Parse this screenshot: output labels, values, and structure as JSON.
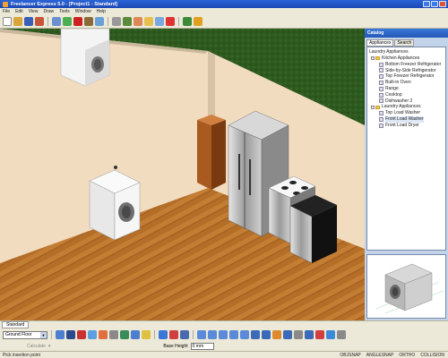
{
  "window": {
    "title": "Freelancer Express 5.0 - [Project1 - Standard]"
  },
  "menu": [
    "File",
    "Edit",
    "View",
    "Draw",
    "Tools",
    "Window",
    "Help"
  ],
  "catalog": {
    "title": "Catalog",
    "tabs": [
      "Appliances",
      "Search"
    ],
    "header": "Laundry Appliances",
    "tree": [
      {
        "label": "Kitchen Appliances",
        "type": "folder",
        "level": 1,
        "expanded": true
      },
      {
        "label": "Bottom Freezer Refrigerator",
        "type": "item",
        "level": 2
      },
      {
        "label": "Side-by-Side Refrigerator",
        "type": "item",
        "level": 2
      },
      {
        "label": "Top Freezer Refrigerator",
        "type": "item",
        "level": 2
      },
      {
        "label": "Built-in Oven",
        "type": "item",
        "level": 2
      },
      {
        "label": "Range",
        "type": "item",
        "level": 2
      },
      {
        "label": "Cooktop",
        "type": "item",
        "level": 2
      },
      {
        "label": "Dishwasher 2",
        "type": "item",
        "level": 2
      },
      {
        "label": "Laundry Appliances",
        "type": "folder",
        "level": 1,
        "expanded": true
      },
      {
        "label": "Top Load Washer",
        "type": "item",
        "level": 2
      },
      {
        "label": "Front Load Washer",
        "type": "item",
        "level": 2,
        "selected": true
      },
      {
        "label": "Front Load Dryer",
        "type": "item",
        "level": 2
      }
    ]
  },
  "view_tab": "Standard",
  "floor_select": {
    "value": "Ground Floor"
  },
  "dropdown_label": "Calculate",
  "base_height": {
    "label": "Base Height",
    "value": "0 mm"
  },
  "status": {
    "message": "Pick insertion point",
    "toggles": [
      "OBJSNAP",
      "ANGLESNAP",
      "ORTHO",
      "COLLISION"
    ]
  },
  "colors": {
    "title_bar": "#1c48b5",
    "wall": "#f2dcc0",
    "floor": "#b8732a",
    "grass": "#2e5a1f"
  }
}
